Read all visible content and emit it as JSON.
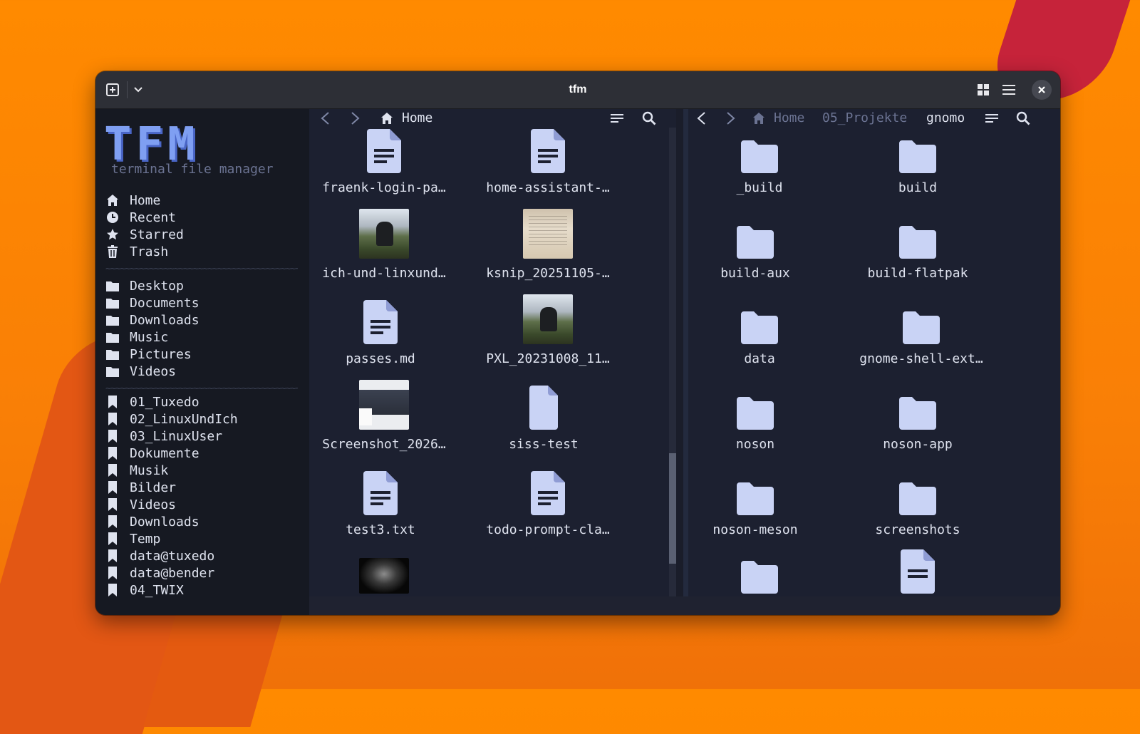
{
  "window": {
    "title": "tfm"
  },
  "sidebar": {
    "logo": "TFM",
    "subtitle": "terminal file manager",
    "places": [
      {
        "label": "Home",
        "icon": "home-icon"
      },
      {
        "label": "Recent",
        "icon": "clock-icon"
      },
      {
        "label": "Starred",
        "icon": "star-icon"
      },
      {
        "label": "Trash",
        "icon": "trash-icon"
      }
    ],
    "divider": "~~~~~~~~~~~~~~~~~~~~~~~~~~~~~~~~~~~~~~~~",
    "folders": [
      {
        "label": "Desktop",
        "icon": "folder-icon"
      },
      {
        "label": "Documents",
        "icon": "folder-icon"
      },
      {
        "label": "Downloads",
        "icon": "folder-icon"
      },
      {
        "label": "Music",
        "icon": "folder-icon"
      },
      {
        "label": "Pictures",
        "icon": "folder-icon"
      },
      {
        "label": "Videos",
        "icon": "folder-icon"
      }
    ],
    "bookmarks": [
      {
        "label": "01_Tuxedo",
        "icon": "bookmark-icon"
      },
      {
        "label": "02_LinuxUndIch",
        "icon": "bookmark-icon"
      },
      {
        "label": "03_LinuxUser",
        "icon": "bookmark-icon"
      },
      {
        "label": "Dokumente",
        "icon": "bookmark-icon"
      },
      {
        "label": "Musik",
        "icon": "bookmark-icon"
      },
      {
        "label": "Bilder",
        "icon": "bookmark-icon"
      },
      {
        "label": "Videos",
        "icon": "bookmark-icon"
      },
      {
        "label": "Downloads",
        "icon": "bookmark-icon"
      },
      {
        "label": "Temp",
        "icon": "bookmark-icon"
      },
      {
        "label": "data@tuxedo",
        "icon": "bookmark-icon"
      },
      {
        "label": "data@bender",
        "icon": "bookmark-icon"
      },
      {
        "label": "04_TWIX",
        "icon": "bookmark-icon"
      }
    ]
  },
  "left_pane": {
    "breadcrumb": [
      "Home"
    ],
    "files": [
      {
        "name": "fraenk-login-pa…",
        "type": "document"
      },
      {
        "name": "home-assistant-…",
        "type": "document"
      },
      {
        "name": "ich-und-linxund…",
        "type": "photo"
      },
      {
        "name": "ksnip_20251105-…",
        "type": "paper-photo"
      },
      {
        "name": "passes.md",
        "type": "document"
      },
      {
        "name": "PXL_20231008_11…",
        "type": "photo"
      },
      {
        "name": "Screenshot_2026…",
        "type": "screenshot"
      },
      {
        "name": "siss-test",
        "type": "blank"
      },
      {
        "name": "test3.txt",
        "type": "document"
      },
      {
        "name": "todo-prompt-cla…",
        "type": "document"
      },
      {
        "name": "",
        "type": "dark-photo"
      }
    ]
  },
  "right_pane": {
    "breadcrumb": [
      "Home",
      "05_Projekte",
      "gnomo"
    ],
    "files": [
      {
        "name": "_build",
        "type": "folder"
      },
      {
        "name": "build",
        "type": "folder"
      },
      {
        "name": "build-aux",
        "type": "folder"
      },
      {
        "name": "build-flatpak",
        "type": "folder"
      },
      {
        "name": "data",
        "type": "folder"
      },
      {
        "name": "gnome-shell-ext…",
        "type": "folder"
      },
      {
        "name": "noson",
        "type": "folder"
      },
      {
        "name": "noson-app",
        "type": "folder"
      },
      {
        "name": "noson-meson",
        "type": "folder"
      },
      {
        "name": "screenshots",
        "type": "folder"
      },
      {
        "name": "",
        "type": "folder"
      },
      {
        "name": "",
        "type": "document"
      }
    ]
  },
  "colors": {
    "accent": "#7f9ff2",
    "icon_fill": "#c9d3f5",
    "text": "#dfe3ef",
    "muted": "#6b7392",
    "pane_bg": "#1c2030",
    "sidebar_bg": "#161922"
  }
}
